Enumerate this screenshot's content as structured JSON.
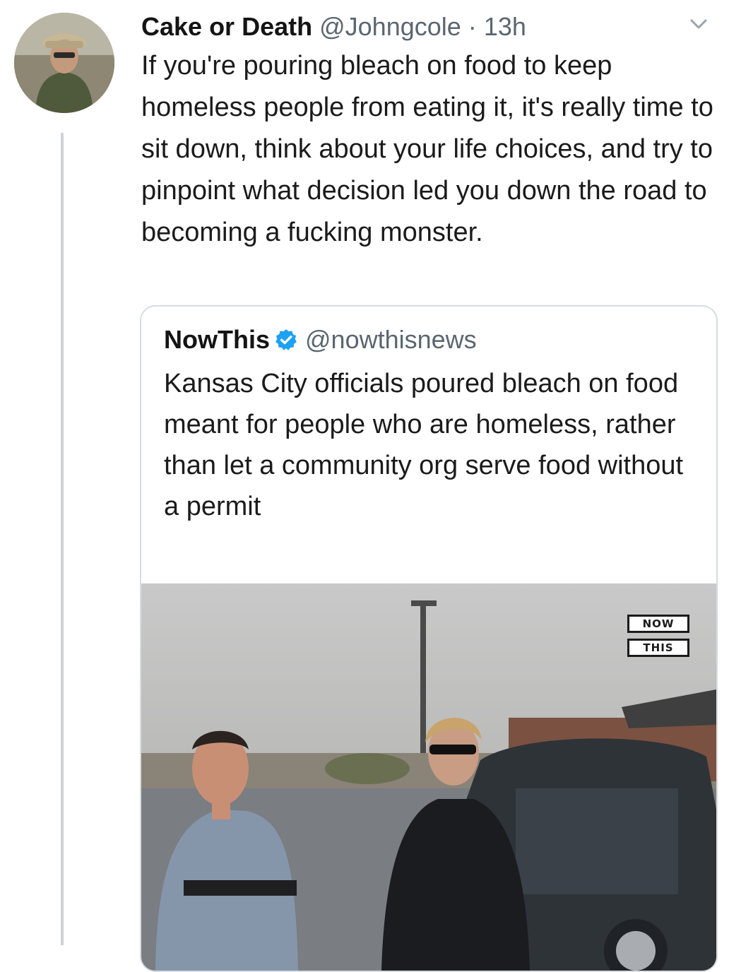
{
  "tweet": {
    "display_name": "Cake or Death",
    "handle": "@Johngcole",
    "separator": "·",
    "time": "13h",
    "text": "If you're pouring bleach on food to keep homeless people from eating it, it's really time to sit down, think about your life choices, and try to pinpoint what decision led you down the road to becoming a fucking monster."
  },
  "quoted_tweet": {
    "display_name": "NowThis",
    "handle": "@nowthisnews",
    "verified": true,
    "text": "Kansas City officials poured bleach on food meant for people who are homeless, rather than let a community org serve food without a permit",
    "media": {
      "logo_top": "NOW",
      "logo_bottom": "THIS"
    }
  },
  "colors": {
    "verified_badge": "#1da1f2",
    "secondary_text": "#5b6670",
    "card_border": "#d8dcdf"
  },
  "icons": {
    "verified": "verified-badge-icon",
    "menu": "chevron-down-icon"
  }
}
